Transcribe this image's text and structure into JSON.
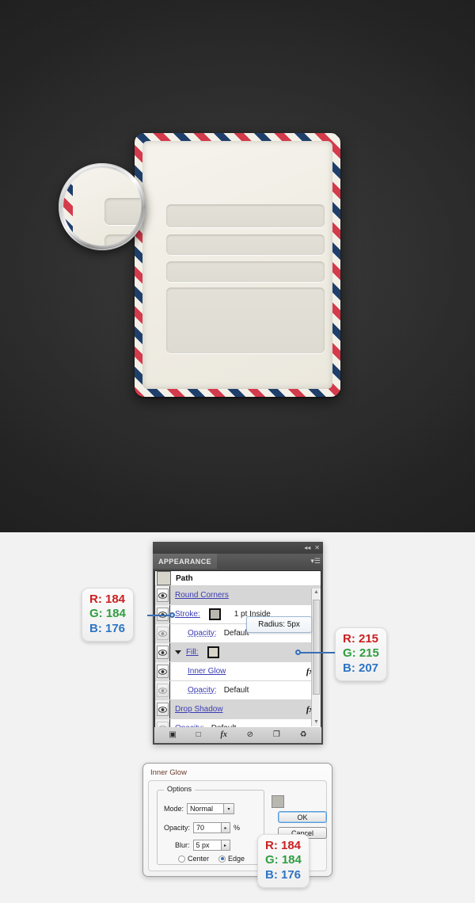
{
  "artwork": {
    "envelope_name": "airmail-envelope",
    "stripe_red": "#d33a4b",
    "stripe_blue": "#1f3f6b",
    "paper": "#f3f0e8",
    "field_fill": "#e3e1d7"
  },
  "panel": {
    "tab_label": "APPEARANCE",
    "collapse_icon": "◂◂",
    "close_icon": "✕",
    "menu_icon": "▾☰",
    "path_label": "Path",
    "tooltip": "Radius: 5px",
    "scroll_up": "▲",
    "scroll_down": "▼",
    "rows": [
      {
        "name": "round-corners",
        "label": "Round Corners",
        "value": "",
        "selected": true,
        "indent": false,
        "swatch": null,
        "fx": false,
        "eye": true,
        "disclosure": false
      },
      {
        "name": "stroke",
        "label": "Stroke:",
        "value": "1 pt  Inside",
        "selected": false,
        "indent": false,
        "swatch": "stroke",
        "fx": false,
        "eye": true,
        "disclosure": false
      },
      {
        "name": "stroke-opacity",
        "label": "Opacity:",
        "value": "Default",
        "selected": false,
        "indent": true,
        "swatch": null,
        "fx": false,
        "eye": false,
        "disclosure": false
      },
      {
        "name": "fill",
        "label": "Fill:",
        "value": "",
        "selected": true,
        "indent": false,
        "swatch": "fill",
        "fx": false,
        "eye": true,
        "disclosure": true
      },
      {
        "name": "inner-glow",
        "label": "Inner Glow",
        "value": "",
        "selected": false,
        "indent": true,
        "swatch": null,
        "fx": true,
        "eye": true,
        "disclosure": false
      },
      {
        "name": "fill-opacity",
        "label": "Opacity:",
        "value": "Default",
        "selected": false,
        "indent": true,
        "swatch": null,
        "fx": false,
        "eye": false,
        "disclosure": false
      },
      {
        "name": "drop-shadow",
        "label": "Drop Shadow",
        "value": "",
        "selected": true,
        "indent": false,
        "swatch": null,
        "fx": true,
        "eye": true,
        "disclosure": false
      },
      {
        "name": "object-opacity",
        "label": "Opacity:",
        "value": "Default",
        "selected": false,
        "indent": false,
        "swatch": null,
        "fx": false,
        "eye": false,
        "disclosure": false
      }
    ],
    "footer_icons": [
      "▣",
      "□",
      "fx",
      "⊘",
      "❐",
      "♻"
    ]
  },
  "dialog": {
    "title": "Inner Glow",
    "options_legend": "Options",
    "mode_label": "Mode:",
    "mode_value": "Normal",
    "opacity_label": "Opacity:",
    "opacity_value": "70",
    "opacity_unit": "%",
    "blur_label": "Blur:",
    "blur_value": "5 px",
    "center_label": "Center",
    "edge_label": "Edge",
    "ok_label": "OK",
    "cancel_label": "Cancel",
    "arrow_glyph": "▸",
    "caret_glyph": "▾"
  },
  "callouts": {
    "stroke_color": {
      "r": "R: 184",
      "g": "G: 184",
      "b": "B: 176"
    },
    "fill_color": {
      "r": "R: 215",
      "g": "G: 215",
      "b": "B: 207"
    },
    "glow_color": {
      "r": "R: 184",
      "g": "G: 184",
      "b": "B: 176"
    }
  }
}
